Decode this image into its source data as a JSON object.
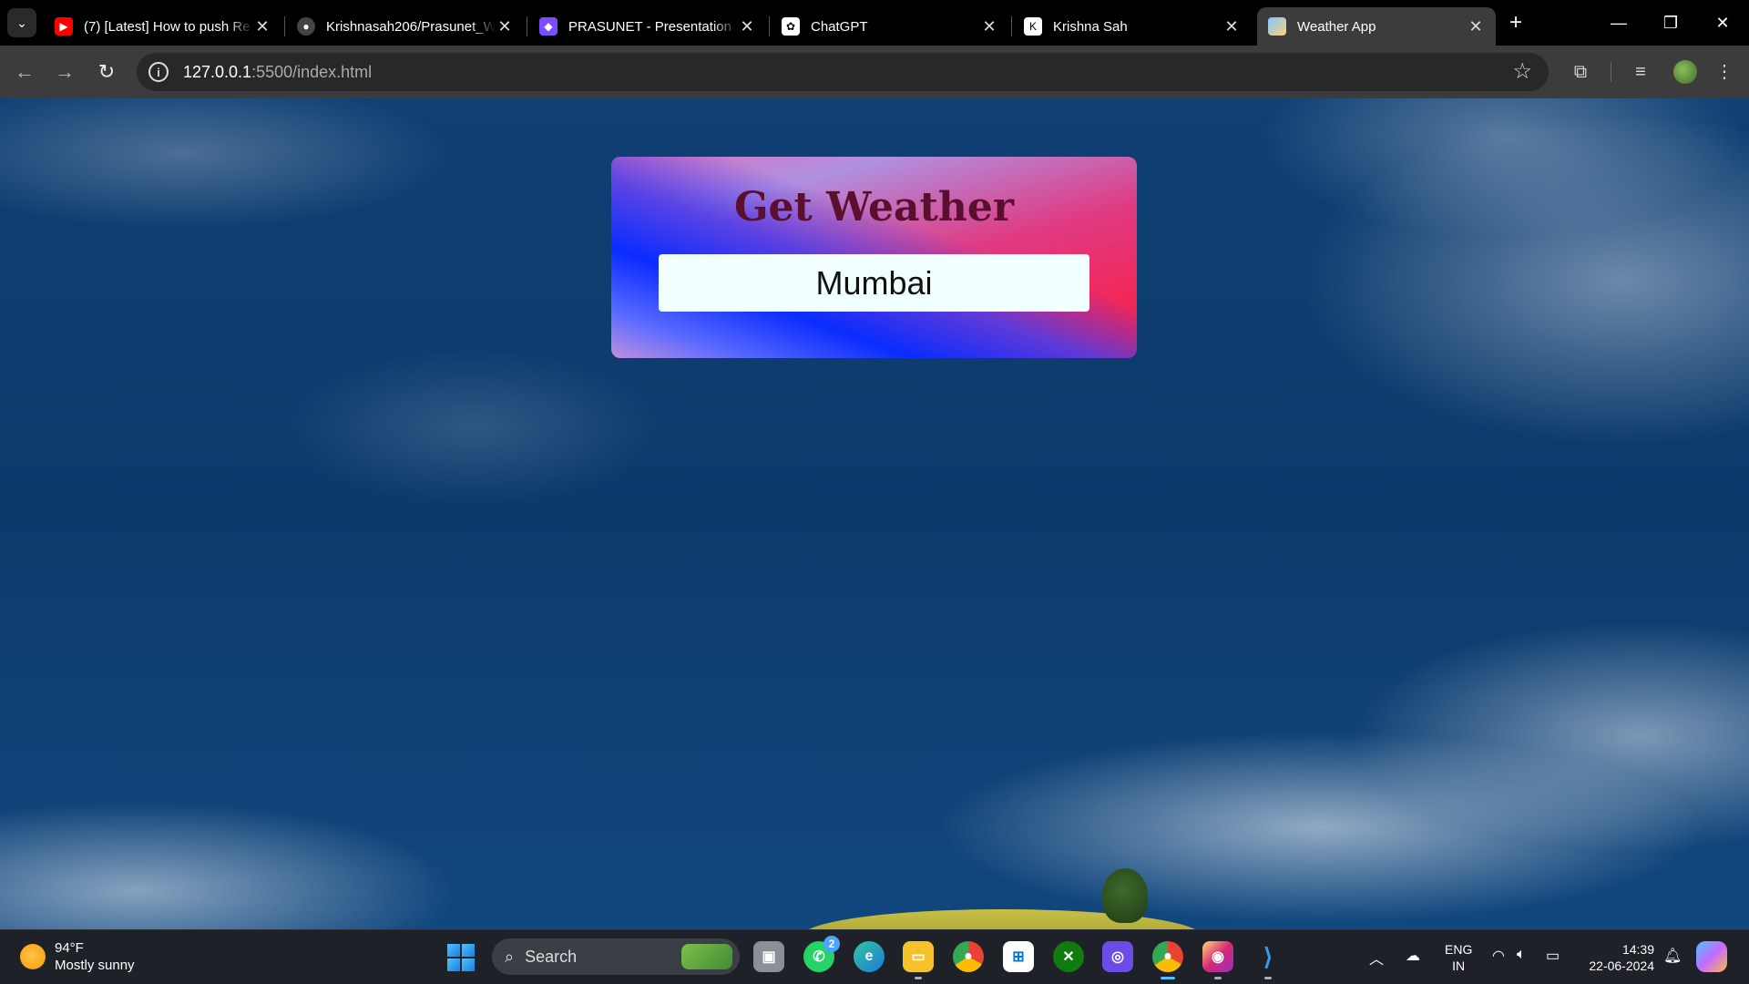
{
  "browser": {
    "tabs": [
      {
        "title": "(7) [Latest] How to push Re",
        "favicon": "youtube-icon",
        "color": "#ff0000",
        "active": false
      },
      {
        "title": "Krishnasah206/Prasunet_W",
        "favicon": "github-icon",
        "color": "#444444",
        "active": false
      },
      {
        "title": "PRASUNET - Presentation",
        "favicon": "canva-icon",
        "color": "#7b4dff",
        "active": false
      },
      {
        "title": "ChatGPT",
        "favicon": "chatgpt-icon",
        "color": "#ffffff",
        "active": false
      },
      {
        "title": "Krishna Sah",
        "favicon": "k-logo-icon",
        "color": "#ffffff",
        "active": false
      },
      {
        "title": "Weather App",
        "favicon": "weather-icon",
        "color": "#7fc6ff",
        "active": true
      }
    ],
    "url_host": "127.0.0.1",
    "url_rest": ":5500/index.html"
  },
  "page": {
    "title": "Get Weather",
    "city_input": {
      "value": "Mumbai",
      "placeholder": ""
    }
  },
  "taskbar": {
    "weather": {
      "temp": "94°F",
      "condition": "Mostly sunny"
    },
    "search_label": "Search",
    "whatsapp_badge": "2",
    "language": {
      "line1": "ENG",
      "line2": "IN"
    },
    "clock": {
      "time": "14:39",
      "date": "22-06-2024"
    }
  }
}
